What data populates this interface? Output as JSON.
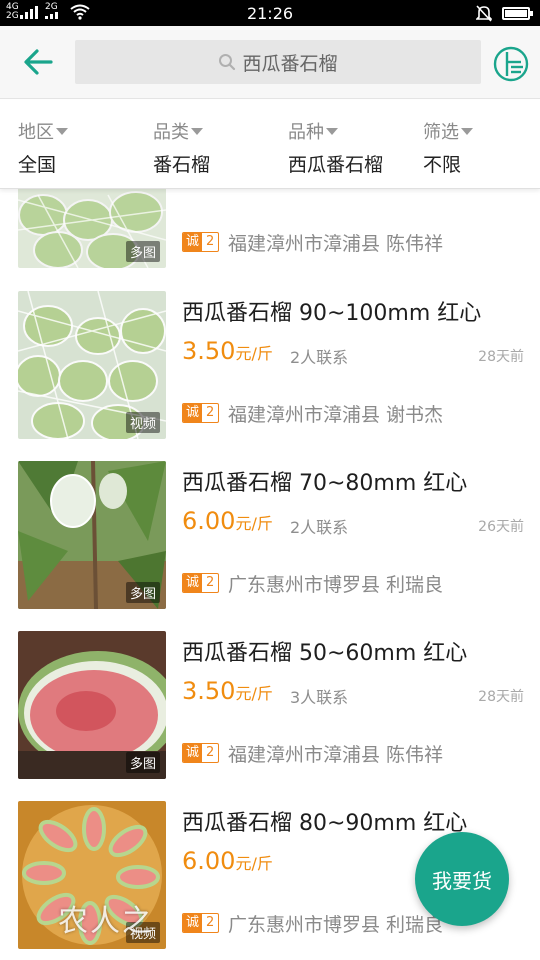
{
  "status_bar": {
    "network_top": "4G",
    "network_bottom": "2G",
    "network2": "2G",
    "time": "21:26"
  },
  "header": {
    "search_query": "西瓜番石榴",
    "icons": {
      "back": "back-arrow-icon",
      "search": "search-icon",
      "menu": "list-menu-icon"
    },
    "accent_color": "#1aa58c"
  },
  "filters": [
    {
      "label": "地区",
      "value": "全国"
    },
    {
      "label": "品类",
      "value": "番石榴"
    },
    {
      "label": "品种",
      "value": "西瓜番石榴"
    },
    {
      "label": "筛选",
      "value": "不限"
    }
  ],
  "listings": [
    {
      "title": "",
      "price": "",
      "unit": "",
      "contacts": "",
      "ago": "",
      "media_tag": "多图",
      "badge_a": "诚",
      "badge_b": "2",
      "location": "福建漳州市漳浦县 陈伟祥",
      "image": "guava-net-crate"
    },
    {
      "title": "西瓜番石榴 90~100mm 红心",
      "price": "3.50",
      "unit": "元/斤",
      "contacts": "2人联系",
      "ago": "28天前",
      "media_tag": "视频",
      "badge_a": "诚",
      "badge_b": "2",
      "location": "福建漳州市漳浦县 谢书杰",
      "image": "guava-net-crate"
    },
    {
      "title": "西瓜番石榴 70~80mm 红心",
      "price": "6.00",
      "unit": "元/斤",
      "contacts": "2人联系",
      "ago": "26天前",
      "media_tag": "多图",
      "badge_a": "诚",
      "badge_b": "2",
      "location": "广东惠州市博罗县 利瑞良",
      "image": "guava-tree"
    },
    {
      "title": "西瓜番石榴 50~60mm 红心",
      "price": "3.50",
      "unit": "元/斤",
      "contacts": "3人联系",
      "ago": "28天前",
      "media_tag": "多图",
      "badge_a": "诚",
      "badge_b": "2",
      "location": "福建漳州市漳浦县 陈伟祥",
      "image": "guava-cut"
    },
    {
      "title": "西瓜番石榴 80~90mm 红心",
      "price": "6.00",
      "unit": "元/斤",
      "contacts": "",
      "ago": "",
      "media_tag": "视频",
      "badge_a": "诚",
      "badge_b": "2",
      "location": "广东惠州市博罗县 利瑞良",
      "image": "guava-slices"
    }
  ],
  "fab_label": "我要货",
  "watermark": "农人之"
}
